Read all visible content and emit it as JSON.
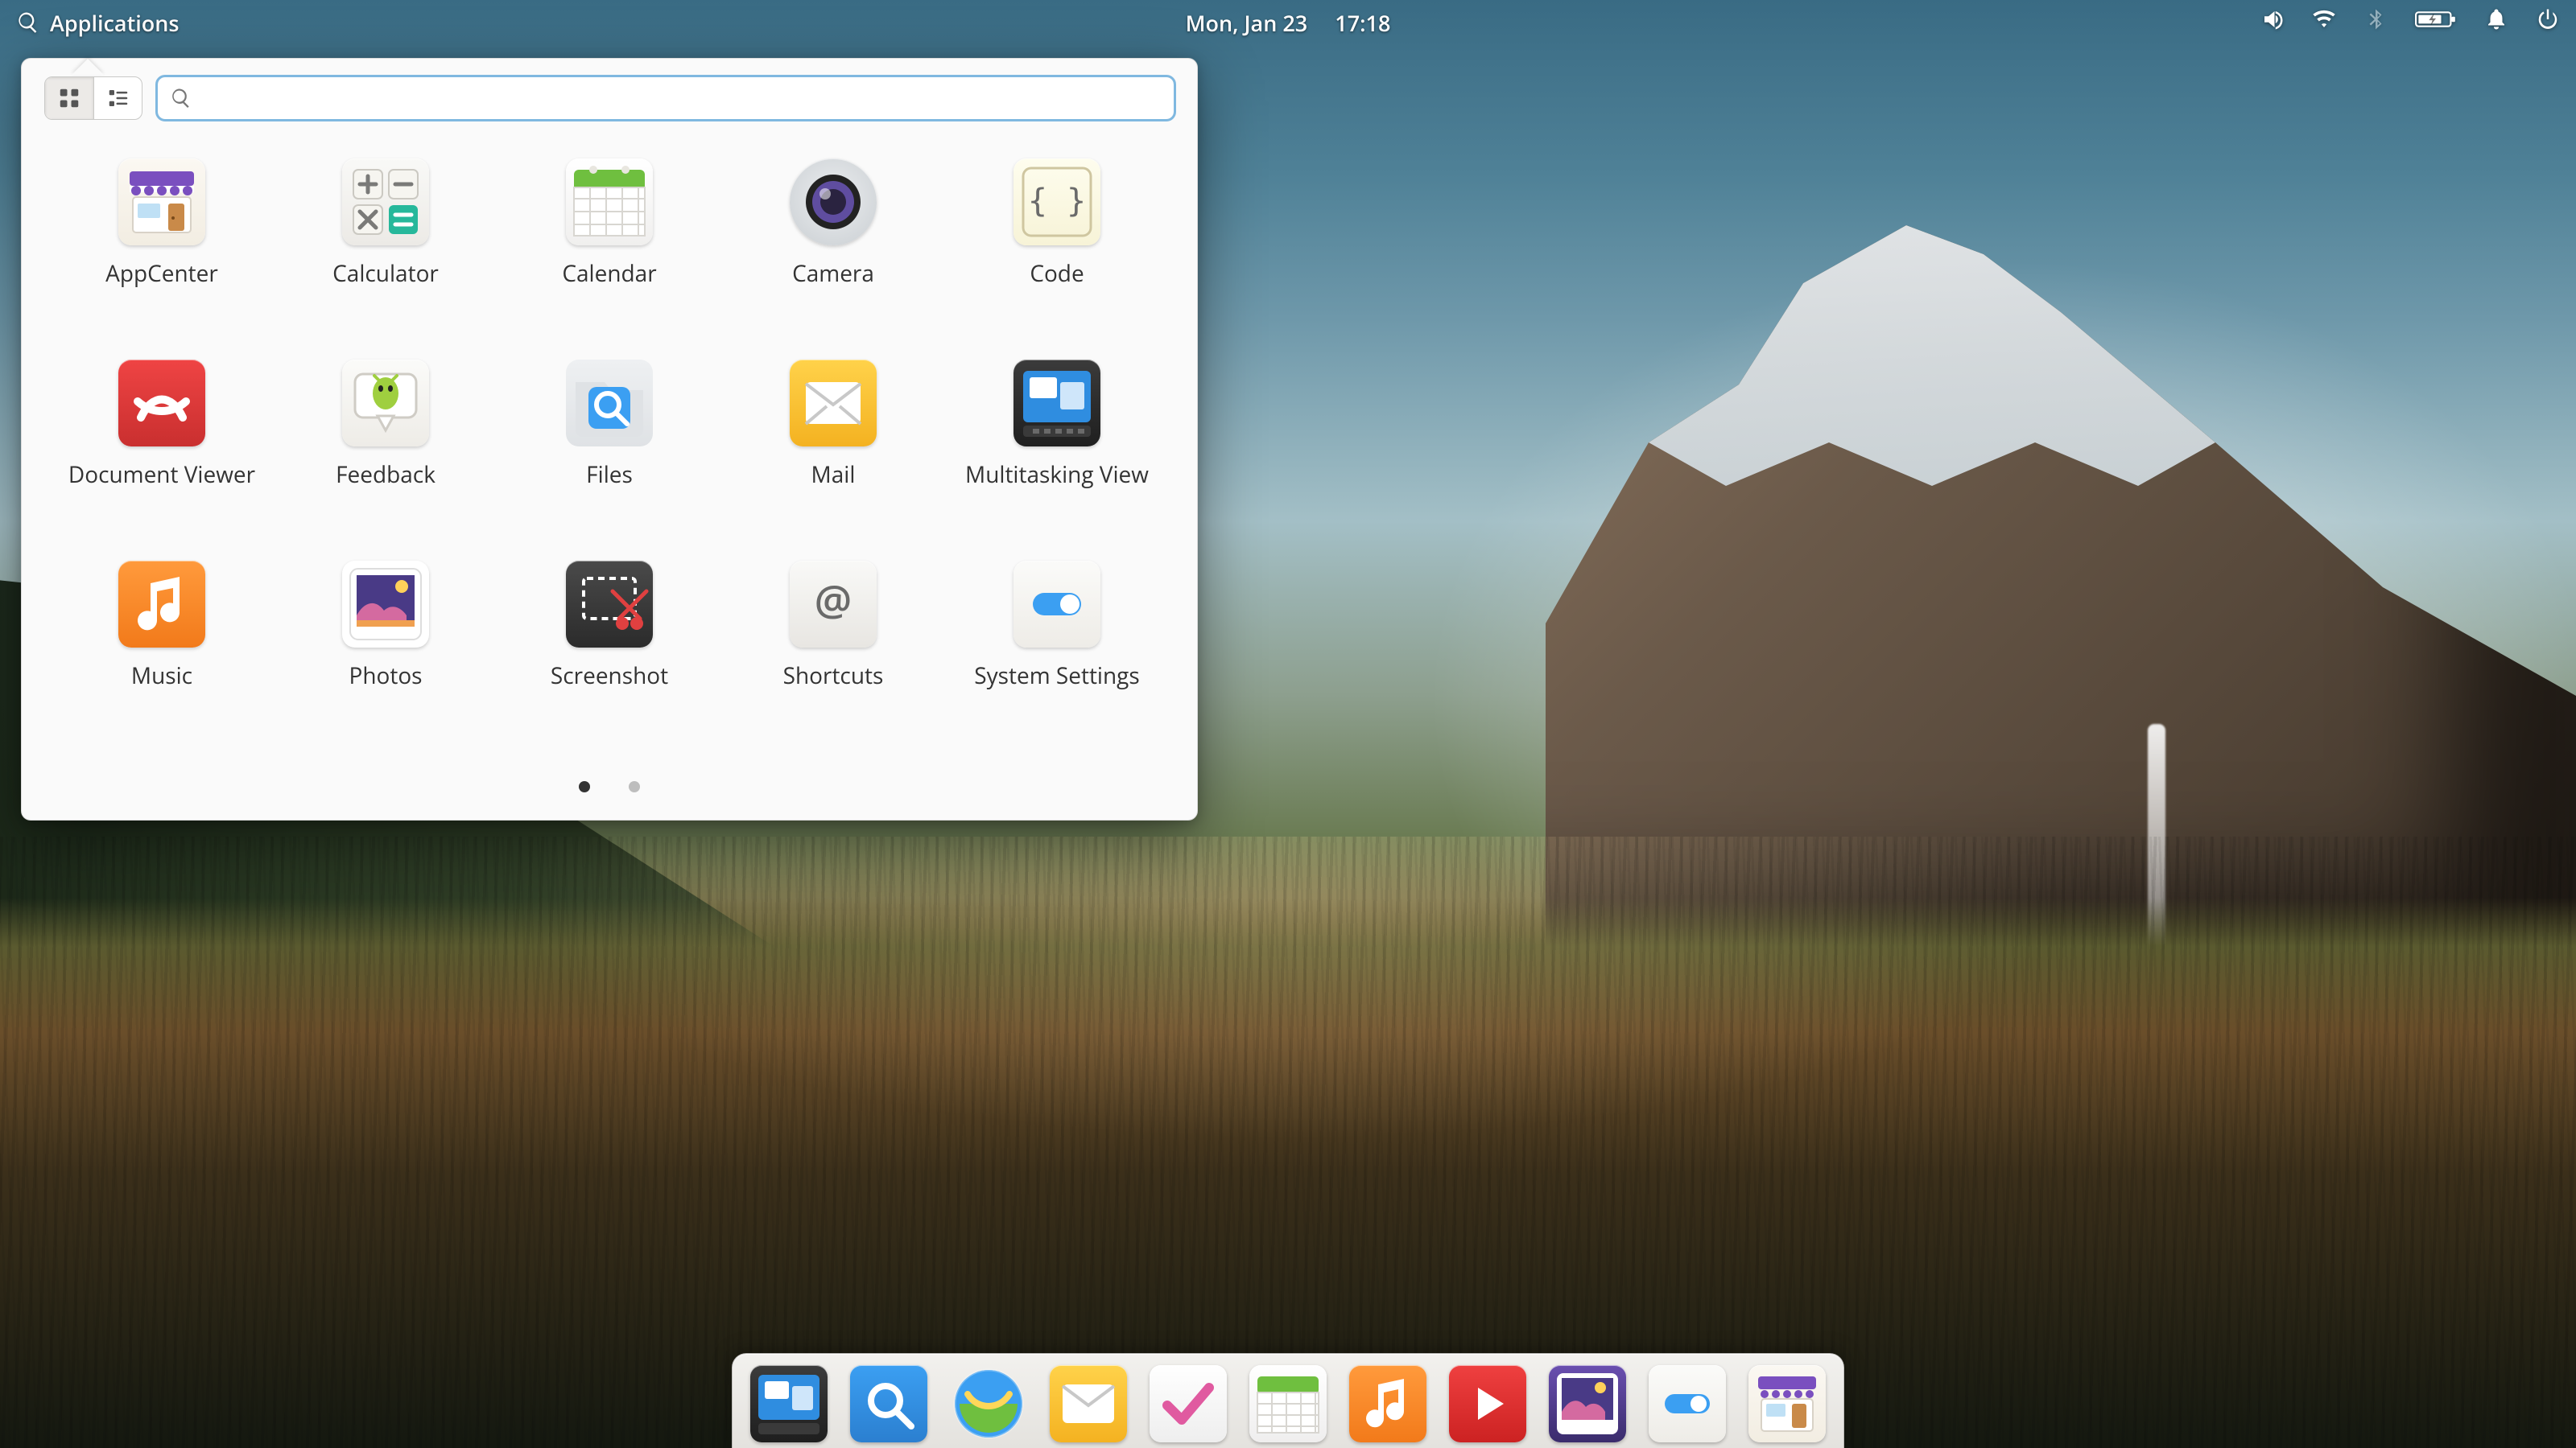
{
  "panel": {
    "applications_label": "Applications",
    "date": "Mon, Jan 23",
    "time": "17:18",
    "indicators": [
      "volume",
      "wifi",
      "bluetooth",
      "battery",
      "notifications",
      "power"
    ]
  },
  "popover": {
    "search_value": "",
    "search_placeholder": "",
    "view_mode": "grid",
    "pages": {
      "current": 1,
      "total": 2
    },
    "apps": [
      {
        "name": "AppCenter",
        "icon": "appcenter-icon"
      },
      {
        "name": "Calculator",
        "icon": "calculator-icon"
      },
      {
        "name": "Calendar",
        "icon": "calendar-icon"
      },
      {
        "name": "Camera",
        "icon": "camera-icon"
      },
      {
        "name": "Code",
        "icon": "code-icon"
      },
      {
        "name": "Document Viewer",
        "icon": "document-viewer-icon"
      },
      {
        "name": "Feedback",
        "icon": "feedback-icon"
      },
      {
        "name": "Files",
        "icon": "files-icon"
      },
      {
        "name": "Mail",
        "icon": "mail-icon"
      },
      {
        "name": "Multitasking View",
        "icon": "multitasking-view-icon"
      },
      {
        "name": "Music",
        "icon": "music-icon"
      },
      {
        "name": "Photos",
        "icon": "photos-icon"
      },
      {
        "name": "Screenshot",
        "icon": "screenshot-icon"
      },
      {
        "name": "Shortcuts",
        "icon": "shortcuts-icon"
      },
      {
        "name": "System Settings",
        "icon": "system-settings-icon"
      }
    ]
  },
  "dock": {
    "items": [
      {
        "name": "Multitasking View",
        "icon": "multitasking-view-icon"
      },
      {
        "name": "Files",
        "icon": "files-icon"
      },
      {
        "name": "Web",
        "icon": "web-browser-icon"
      },
      {
        "name": "Mail",
        "icon": "mail-icon"
      },
      {
        "name": "Tasks",
        "icon": "tasks-icon"
      },
      {
        "name": "Calendar",
        "icon": "calendar-icon"
      },
      {
        "name": "Music",
        "icon": "music-icon"
      },
      {
        "name": "Videos",
        "icon": "videos-icon"
      },
      {
        "name": "Photos",
        "icon": "photos-icon"
      },
      {
        "name": "System Settings",
        "icon": "system-settings-icon"
      },
      {
        "name": "AppCenter",
        "icon": "appcenter-icon"
      }
    ]
  }
}
